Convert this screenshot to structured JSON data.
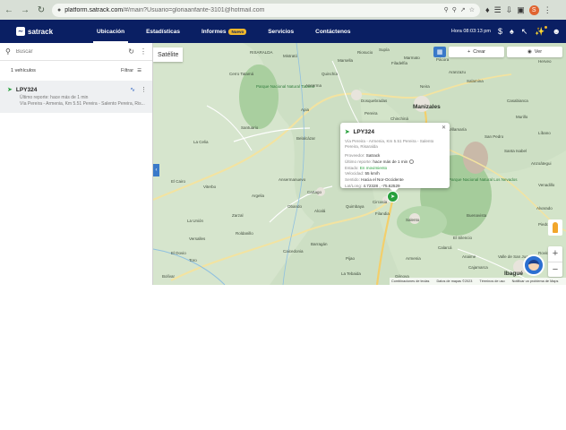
{
  "browser": {
    "url_host": "platform.satrack.com",
    "url_path": "/#/main?Usuario=gloriaanfante-3101@hotmail.com",
    "profile_initial": "S"
  },
  "header": {
    "logo_text": "satrack",
    "menu": [
      {
        "label": "Ubicación",
        "active": true
      },
      {
        "label": "Estadísticas"
      },
      {
        "label": "Informes",
        "badge": "Nuevo"
      },
      {
        "label": "Servicios"
      },
      {
        "label": "Contáctenos"
      }
    ],
    "clock": "Hora 08:03:13 pm"
  },
  "sidebar": {
    "search_placeholder": "Buscar",
    "vehicle_count": "1 vehículos",
    "filter_label": "Filtrar",
    "vehicle": {
      "plate": "LPY324",
      "last_report": "Último reporte: hace más de 1 min",
      "address": "Vía Pereira - Armenia, Km 5.51 Pereira - Salento Pereira, Ris..."
    }
  },
  "map": {
    "toggle_label": "Satélite",
    "create_label": "Crear",
    "view_label": "Ver",
    "attribution": [
      "Combinaciones de teclas",
      "Datos de mapas ©2023",
      "Términos de uso",
      "Notificar un problema de Maps"
    ],
    "places": [
      {
        "name": "RISARALDA",
        "type": "region"
      },
      {
        "name": "Cerro Tatamá",
        "type": "place"
      },
      {
        "name": "Parque Nacional Natural Tatamá",
        "type": "park"
      },
      {
        "name": "Marsella",
        "type": "place"
      },
      {
        "name": "Manizales",
        "type": "city"
      },
      {
        "name": "Santa Rosa de Cabal",
        "type": "place"
      },
      {
        "name": "Parque Nacional Natural Los Nevados",
        "type": "park"
      },
      {
        "name": "Pereira",
        "type": "place"
      },
      {
        "name": "Dosquebradas",
        "type": "place"
      },
      {
        "name": "Santuario",
        "type": "place"
      },
      {
        "name": "La Celia",
        "type": "place"
      },
      {
        "name": "Viterbo",
        "type": "place"
      },
      {
        "name": "Anserma",
        "type": "place"
      },
      {
        "name": "Belalcázar",
        "type": "place"
      },
      {
        "name": "Cartago",
        "type": "place"
      },
      {
        "name": "Filandia",
        "type": "place"
      },
      {
        "name": "Salento",
        "type": "place"
      },
      {
        "name": "Armenia",
        "type": "place"
      },
      {
        "name": "La Tebaida",
        "type": "place"
      },
      {
        "name": "Ibagué",
        "type": "city"
      },
      {
        "name": "Cajamarca",
        "type": "place"
      },
      {
        "name": "Villamaría",
        "type": "place"
      },
      {
        "name": "Chinchiná",
        "type": "place"
      },
      {
        "name": "Neira",
        "type": "place"
      },
      {
        "name": "El Cairo",
        "type": "place"
      },
      {
        "name": "Ansermanuevo",
        "type": "place"
      },
      {
        "name": "Argelia",
        "type": "place"
      },
      {
        "name": "Obando",
        "type": "place"
      },
      {
        "name": "Alcalá",
        "type": "place"
      },
      {
        "name": "Quimbaya",
        "type": "place"
      },
      {
        "name": "Circasia",
        "type": "place"
      },
      {
        "name": "Calarcá",
        "type": "place"
      },
      {
        "name": "Zarzal",
        "type": "place"
      },
      {
        "name": "Roldanillo",
        "type": "place"
      },
      {
        "name": "La Unión",
        "type": "place"
      },
      {
        "name": "Versalles",
        "type": "place"
      },
      {
        "name": "El Dovio",
        "type": "place"
      },
      {
        "name": "Toro",
        "type": "place"
      },
      {
        "name": "Bolívar",
        "type": "place"
      },
      {
        "name": "Caicedonia",
        "type": "place"
      },
      {
        "name": "Barragán",
        "type": "place"
      },
      {
        "name": "Génova",
        "type": "place"
      },
      {
        "name": "Pijao",
        "type": "place"
      },
      {
        "name": "Rovira",
        "type": "place"
      },
      {
        "name": "El Silencio",
        "type": "place"
      },
      {
        "name": "Valle de San Juan",
        "type": "place"
      },
      {
        "name": "Anaime",
        "type": "place"
      },
      {
        "name": "Buenavista",
        "type": "place"
      },
      {
        "name": "Salamina",
        "type": "place"
      },
      {
        "name": "Aranzazu",
        "type": "place"
      },
      {
        "name": "Filadelfia",
        "type": "place"
      },
      {
        "name": "Riosucio",
        "type": "place"
      },
      {
        "name": "Supía",
        "type": "place"
      },
      {
        "name": "Apia",
        "type": "place"
      },
      {
        "name": "Mistrató",
        "type": "place"
      },
      {
        "name": "Quinchía",
        "type": "place"
      },
      {
        "name": "Marmato",
        "type": "place"
      },
      {
        "name": "Pácora",
        "type": "place"
      },
      {
        "name": "Villa Hermosa",
        "type": "place"
      },
      {
        "name": "Herveo",
        "type": "place"
      },
      {
        "name": "Casabianca",
        "type": "place"
      },
      {
        "name": "Murillo",
        "type": "place"
      },
      {
        "name": "Líbano",
        "type": "place"
      },
      {
        "name": "Santa Isabel",
        "type": "place"
      },
      {
        "name": "Anzoátegui",
        "type": "place"
      },
      {
        "name": "Venadillo",
        "type": "place"
      },
      {
        "name": "Alvarado",
        "type": "place"
      },
      {
        "name": "Piedras",
        "type": "place"
      },
      {
        "name": "San Pedro",
        "type": "place"
      }
    ]
  },
  "popup": {
    "plate": "LPY324",
    "address": "Vía Pereira - Armenia, Km 5.51 Pereira - Salento Pereira, Risaralda",
    "rows": [
      {
        "label": "Proveedor:",
        "value": "Satrack"
      },
      {
        "label": "Último reporte:",
        "value": "hace más de 1 min"
      },
      {
        "label": "Estado:",
        "value": "En movimiento"
      },
      {
        "label": "Velocidad:",
        "value": "55 km/h"
      },
      {
        "label": "Sentido:",
        "value": "Hacia el Nor-Occidente"
      },
      {
        "label": "Lat/Long:",
        "value": "4.72328 , -75.62529"
      }
    ]
  }
}
